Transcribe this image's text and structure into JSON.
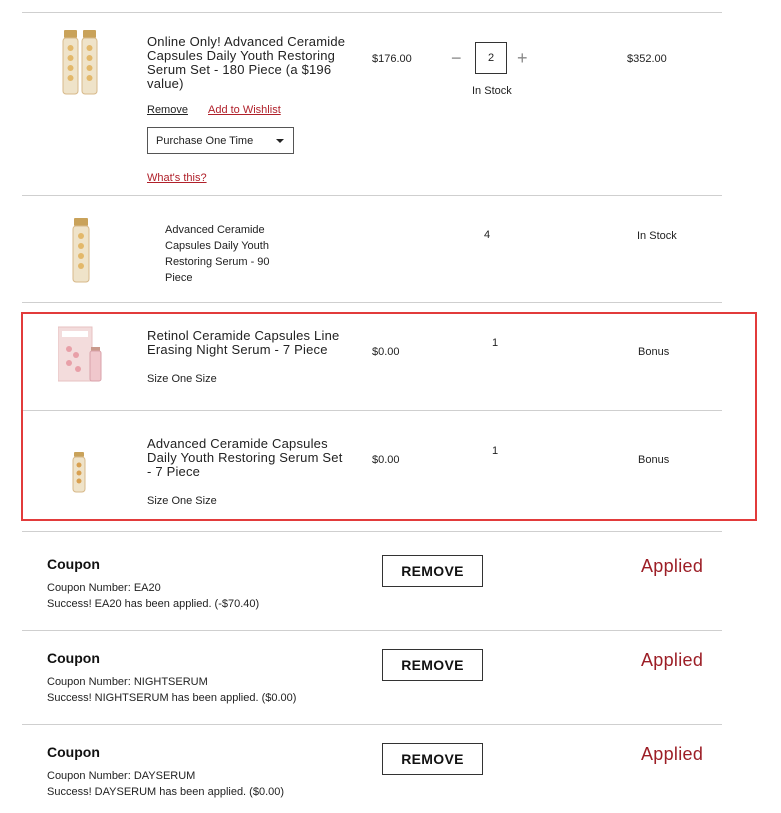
{
  "items": [
    {
      "name": "Online Only! Advanced Ceramide Capsules Daily Youth Restoring Serum Set - 180 Piece (a $196 value)",
      "price": "$176.00",
      "quantity": "2",
      "stock": "In Stock",
      "total": "$352.00",
      "remove_label": "Remove",
      "wishlist_label": "Add to Wishlist",
      "purchase_option": "Purchase One Time",
      "whats_this": "What's this?"
    },
    {
      "name": "Advanced Ceramide Capsules Daily Youth Restoring Serum - 90 Piece",
      "quantity": "4",
      "stock": "In Stock"
    }
  ],
  "bonus_items": [
    {
      "name": "Retinol Ceramide Capsules Line Erasing Night Serum - 7 Piece",
      "size": "Size One Size",
      "price": "$0.00",
      "quantity": "1",
      "status": "Bonus"
    },
    {
      "name": "Advanced Ceramide Capsules Daily Youth Restoring Serum Set - 7 Piece",
      "size": "Size One Size",
      "price": "$0.00",
      "quantity": "1",
      "status": "Bonus"
    }
  ],
  "coupons": [
    {
      "title": "Coupon",
      "number": "Coupon Number: EA20",
      "message": "Success! EA20 has been applied. (-$70.40)",
      "remove_label": "REMOVE",
      "status": "Applied"
    },
    {
      "title": "Coupon",
      "number": "Coupon Number: NIGHTSERUM",
      "message": "Success! NIGHTSERUM has been applied. ($0.00)",
      "remove_label": "REMOVE",
      "status": "Applied"
    },
    {
      "title": "Coupon",
      "number": "Coupon Number: DAYSERUM",
      "message": "Success! DAYSERUM has been applied. ($0.00)",
      "remove_label": "REMOVE",
      "status": "Applied"
    }
  ],
  "icons": {
    "minus": "−",
    "plus": "+"
  },
  "colors": {
    "highlight": "#e23b3b",
    "applied": "#9c1e26",
    "link_red": "#b0202a"
  }
}
